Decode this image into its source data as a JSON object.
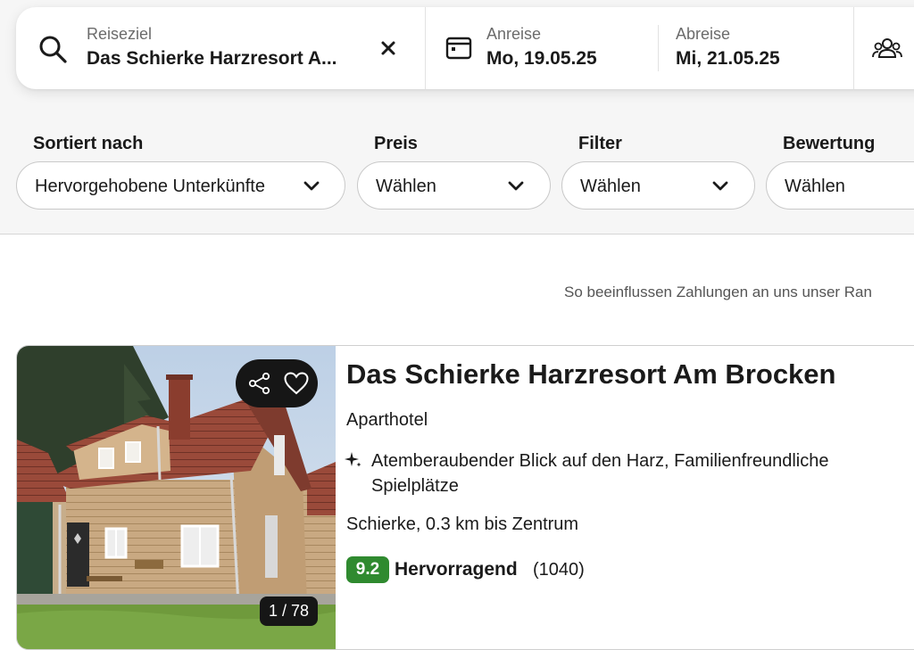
{
  "search": {
    "destination_label": "Reiseziel",
    "destination_value": "Das Schierke Harzresort A...",
    "clear_icon": "close-icon",
    "checkin_label": "Anreise",
    "checkin_value": "Mo, 19.05.25",
    "checkout_label": "Abreise",
    "checkout_value": "Mi, 21.05.25",
    "guests_icon": "guests-icon"
  },
  "filters": {
    "sort_label": "Sortiert nach",
    "sort_value": "Hervorgehobene Unterkünfte",
    "price_label": "Preis",
    "price_value": "Wählen",
    "filter_label": "Filter",
    "filter_value": "Wählen",
    "rating_label": "Bewertung",
    "rating_value": "Wählen"
  },
  "notice": "So beeinflussen Zahlungen an uns unser Ran",
  "listing": {
    "title": "Das Schierke Harzresort Am Brocken",
    "type": "Aparthotel",
    "highlight": "Atemberaubender Blick auf den Harz, Familienfreundliche Spielplätze",
    "location": "Schierke, 0.3 km bis Zentrum",
    "score": "9.2",
    "rating_word": "Hervorragend",
    "rating_count": "(1040)",
    "photo_counter": "1 / 78"
  },
  "colors": {
    "accent_green": "#2f8a2f",
    "dark_pill": "#161616",
    "page_bg": "#f6f6f6"
  }
}
